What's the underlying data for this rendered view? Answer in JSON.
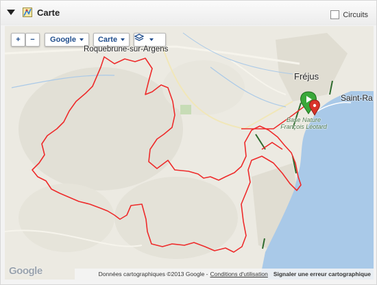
{
  "panel": {
    "title": "Carte",
    "collapse_icon": "collapse-triangle-icon",
    "map_icon": "map-icon",
    "circuits_checkbox": {
      "label": "Circuits",
      "checked": false
    }
  },
  "controls": {
    "zoom_in_label": "+",
    "zoom_out_label": "−",
    "provider_label": "Google",
    "maptype_label": "Carte",
    "layers_icon": "layers-icon"
  },
  "map": {
    "places": {
      "roquebrune": "Roquebrune-sur-Argens",
      "frejus": "Fréjus",
      "saint_raphael": "Saint-Ra"
    },
    "poi": {
      "line1": "Base Nature",
      "line2": "François Léotard"
    },
    "marker_icon": "map-marker-icon",
    "route_color": "#ee2a2a",
    "sea_color": "#a9c9e8",
    "land_color": "#eceae2",
    "footer": {
      "data_text": "Données cartographiques ©2013 Google -",
      "terms_link": "Conditions d'utilisation",
      "report_link": "Signaler une erreur cartographique"
    },
    "logo_text": "Google"
  }
}
